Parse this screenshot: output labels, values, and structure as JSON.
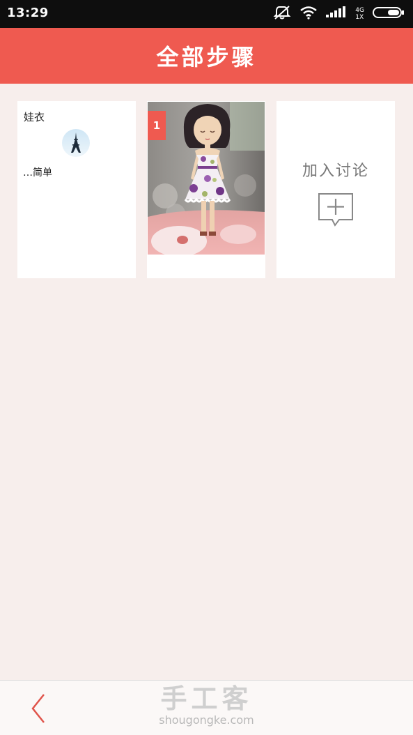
{
  "status_bar": {
    "time": "13:29",
    "network_top": "4G",
    "network_bottom": "1X",
    "icons": [
      "mute-vibrate-icon",
      "wifi-icon",
      "signal-icon",
      "battery-icon"
    ]
  },
  "header": {
    "title": "全部步骤"
  },
  "cards": {
    "author": {
      "title": "娃衣",
      "author_name": "…简单"
    },
    "step": {
      "badge": "1"
    },
    "join": {
      "label": "加入讨论"
    }
  },
  "bottom_bar": {
    "logo_text": "手工客",
    "logo_url": "shougongke.com"
  },
  "colors": {
    "accent": "#ef5a50",
    "background": "#f7eeec",
    "status_bar": "#0e0e0e"
  }
}
